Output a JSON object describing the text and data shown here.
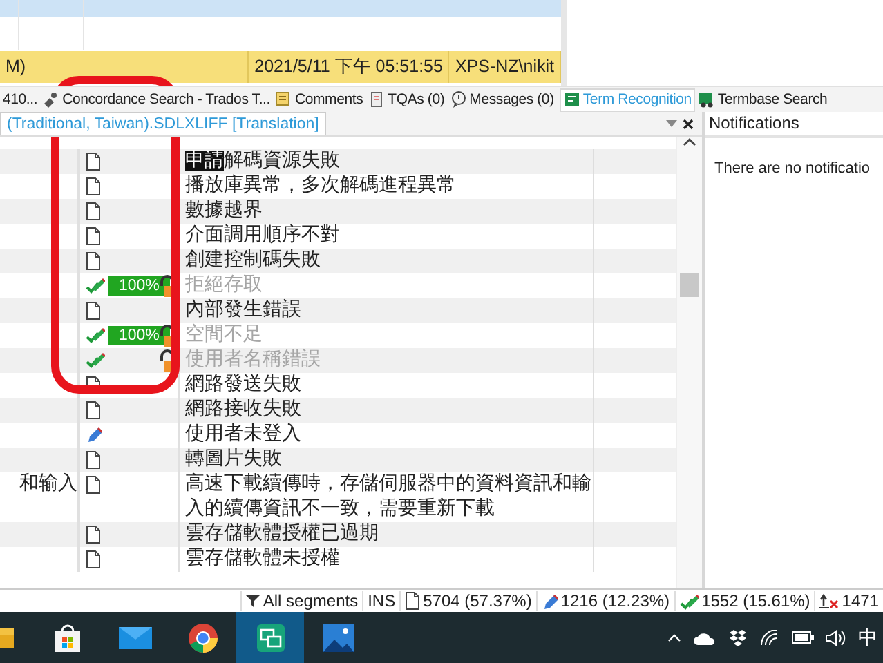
{
  "top_grid": {
    "rows": [
      {
        "selected": true
      },
      {
        "selected": false
      },
      {
        "selected": false
      }
    ],
    "history_row": {
      "cells": [
        "M)",
        "2021/5/11 下午 05:51:55",
        "XPS-NZ\\nikit"
      ]
    }
  },
  "panel_tabs": [
    {
      "label": "410...",
      "kind": "plain",
      "selected": false
    },
    {
      "label": "Concordance Search - Trados T...",
      "kind": "concordance",
      "selected": false
    },
    {
      "label": "Comments",
      "kind": "comments",
      "selected": false
    },
    {
      "label": "TQAs (0)",
      "kind": "tqa",
      "selected": false
    },
    {
      "label": "Messages (0)",
      "kind": "messages",
      "selected": false
    },
    {
      "label": "Term Recognition",
      "kind": "term",
      "selected": true
    },
    {
      "label": "Termbase Search",
      "kind": "termbase",
      "selected": false
    }
  ],
  "editor": {
    "tab_title": "(Traditional, Taiwan).SDLXLIFF [Translation]",
    "rows": [
      {
        "kind": "new",
        "target_marked": "申請",
        "target": "解碼資源失敗",
        "locked": false
      },
      {
        "kind": "new",
        "target": "播放庫異常，多次解碼進程異常",
        "locked": false
      },
      {
        "kind": "new",
        "target": "數據越界",
        "locked": false
      },
      {
        "kind": "new",
        "target": "介面調用順序不對",
        "locked": false
      },
      {
        "kind": "new",
        "target": "創建控制碼失敗",
        "locked": false
      },
      {
        "kind": "translated",
        "match": "100%",
        "target": "拒絕存取",
        "locked": true
      },
      {
        "kind": "new",
        "target": "內部發生錯誤",
        "locked": false
      },
      {
        "kind": "translated",
        "match": "100%",
        "target": "空間不足",
        "locked": true
      },
      {
        "kind": "translated",
        "target": "使用者名稱錯誤",
        "locked": true
      },
      {
        "kind": "new",
        "target": "網路發送失敗",
        "locked": false
      },
      {
        "kind": "new",
        "target": "網路接收失敗",
        "locked": false
      },
      {
        "kind": "draft",
        "target": "使用者未登入",
        "locked": false
      },
      {
        "kind": "new",
        "target": "轉圖片失敗",
        "locked": false
      },
      {
        "source": "和输入",
        "kind": "new",
        "target": "高速下載續傳時，存儲伺服器中的資料資訊和輸入的續傳資訊不一致，需要重新下載",
        "locked": false
      },
      {
        "kind": "new",
        "target": "雲存儲軟體授權已過期",
        "locked": false
      },
      {
        "kind": "new",
        "target": "雲存儲軟體未授權",
        "locked": false
      }
    ]
  },
  "notifications": {
    "title": "Notifications",
    "message": "There are no notificatio"
  },
  "annotation": {
    "kind": "rounded-rectangle"
  },
  "status_bar": [
    {
      "kind": "filter",
      "text": "All segments"
    },
    {
      "kind": "plain",
      "text": "INS"
    },
    {
      "kind": "new",
      "text": "5704 (57.37%)"
    },
    {
      "kind": "draft",
      "text": "1216 (12.23%)"
    },
    {
      "kind": "translated",
      "text": "1552 (15.61%)"
    },
    {
      "kind": "rejected",
      "text": "1471"
    }
  ],
  "taskbar": {
    "apps": [
      {
        "kind": "folder",
        "selected": false
      },
      {
        "kind": "store",
        "selected": false
      },
      {
        "kind": "mail",
        "selected": false
      },
      {
        "kind": "browser",
        "selected": false
      },
      {
        "kind": "chat",
        "selected": true
      },
      {
        "kind": "photos",
        "selected": false
      }
    ],
    "tray": {
      "language": "中"
    }
  }
}
